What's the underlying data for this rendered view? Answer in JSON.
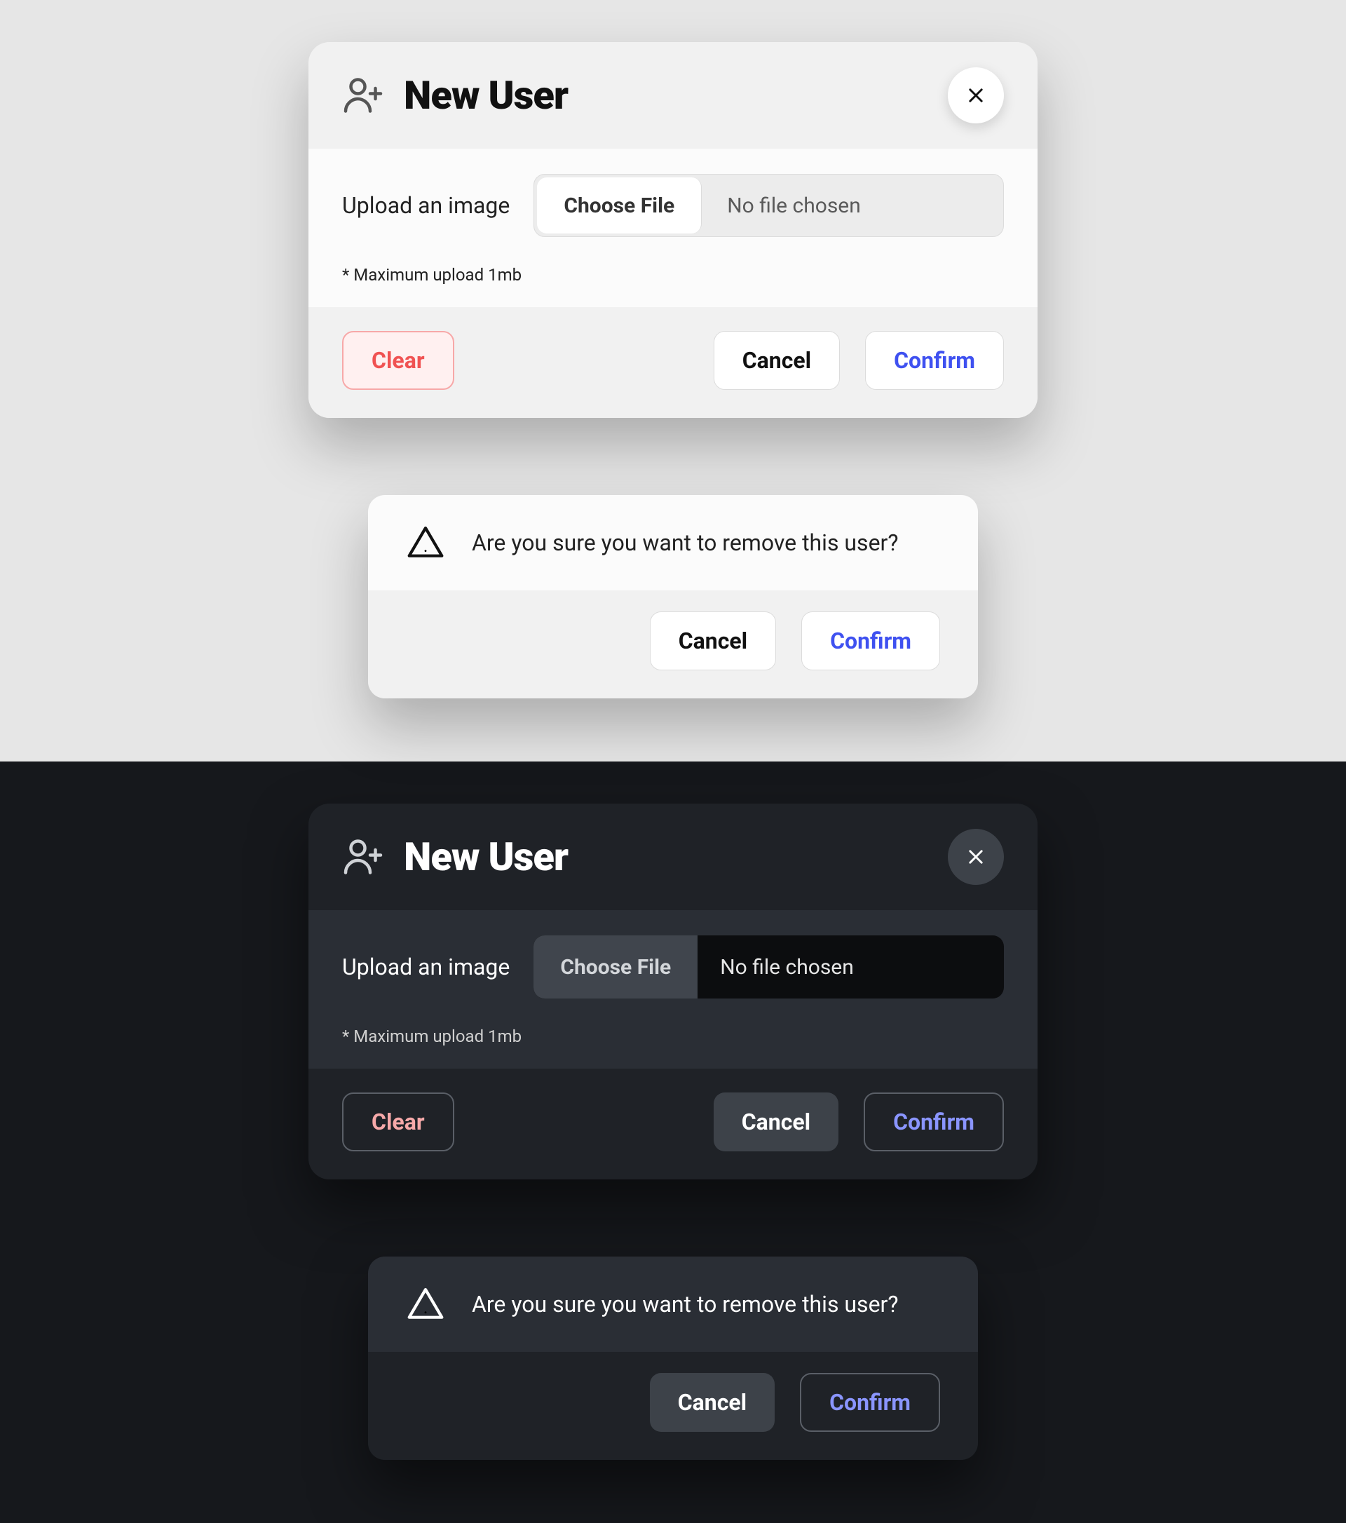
{
  "newUser": {
    "title": "New User",
    "uploadLabel": "Upload an image",
    "chooseFile": "Choose File",
    "fileStatus": "No file chosen",
    "hint": "* Maximum upload 1mb",
    "clear": "Clear",
    "cancel": "Cancel",
    "confirm": "Confirm"
  },
  "removeUser": {
    "prompt": "Are you sure you want to remove this user?",
    "cancel": "Cancel",
    "confirm": "Confirm"
  }
}
